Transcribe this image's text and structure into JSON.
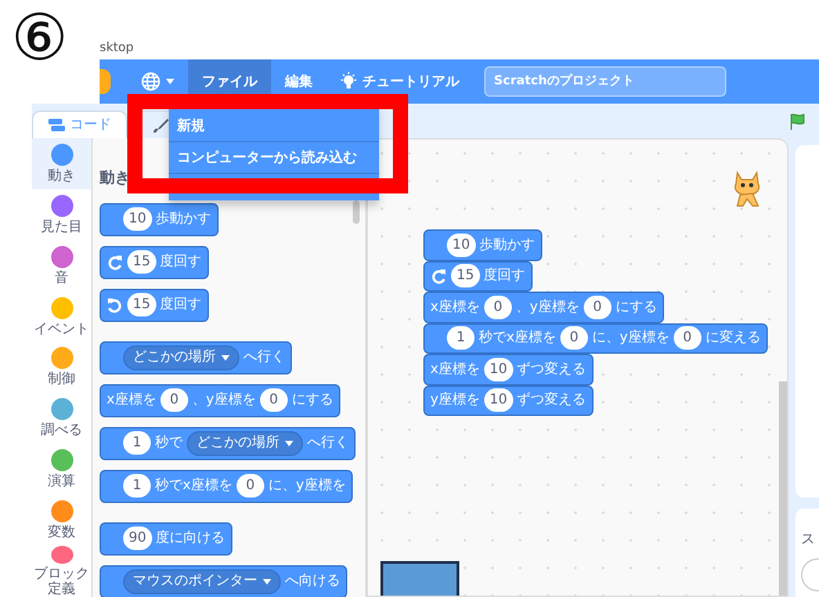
{
  "annotation": {
    "step": "⑥"
  },
  "window": {
    "title": "sktop"
  },
  "menubar": {
    "items": [
      {
        "kind": "language"
      },
      {
        "kind": "menu",
        "label": "ファイル",
        "selected": true
      },
      {
        "kind": "menu",
        "label": "編集",
        "selected": false
      },
      {
        "kind": "tutorial",
        "label": "チュートリアル"
      }
    ],
    "project_title": "Scratchのプロジェクト"
  },
  "tabs": [
    {
      "kind": "code",
      "label": "コード",
      "selected": true
    },
    {
      "kind": "costume",
      "selected": false
    }
  ],
  "file_menu": {
    "items": [
      "新規",
      "コンピューターから読み込む"
    ]
  },
  "categories": [
    {
      "label": "動き",
      "color": "#4c97ff",
      "selected": true
    },
    {
      "label": "見た目",
      "color": "#9966ff",
      "selected": false
    },
    {
      "label": "音",
      "color": "#cf63cf",
      "selected": false
    },
    {
      "label": "イベント",
      "color": "#ffbf00",
      "selected": false
    },
    {
      "label": "制御",
      "color": "#ffab19",
      "selected": false
    },
    {
      "label": "調べる",
      "color": "#5cb1d6",
      "selected": false
    },
    {
      "label": "演算",
      "color": "#59c059",
      "selected": false
    },
    {
      "label": "変数",
      "color": "#ff8c1a",
      "selected": false
    },
    {
      "label": "ブロック定義",
      "color": "#ff6680",
      "selected": false
    }
  ],
  "palette": {
    "heading": "動き",
    "groups": [
      [
        {
          "parts": [
            {
              "kind": "input",
              "text": "10"
            },
            {
              "kind": "label",
              "text": "歩動かす"
            }
          ]
        },
        {
          "parts": [
            {
              "kind": "cw"
            },
            {
              "kind": "input",
              "text": "15"
            },
            {
              "kind": "label",
              "text": "度回す"
            }
          ]
        },
        {
          "parts": [
            {
              "kind": "ccw"
            },
            {
              "kind": "input",
              "text": "15"
            },
            {
              "kind": "label",
              "text": "度回す"
            }
          ]
        }
      ],
      [
        {
          "parts": [
            {
              "kind": "menu",
              "text": "どこかの場所"
            },
            {
              "kind": "label",
              "text": "へ行く"
            }
          ]
        },
        {
          "parts": [
            {
              "kind": "label",
              "text": "x座標を"
            },
            {
              "kind": "input",
              "text": "0"
            },
            {
              "kind": "label",
              "text": "、y座標を"
            },
            {
              "kind": "input",
              "text": "0"
            },
            {
              "kind": "label",
              "text": "にする"
            }
          ]
        },
        {
          "parts": [
            {
              "kind": "input",
              "text": "1"
            },
            {
              "kind": "label",
              "text": "秒で"
            },
            {
              "kind": "menu",
              "text": "どこかの場所"
            },
            {
              "kind": "label",
              "text": "へ行く"
            }
          ]
        },
        {
          "parts": [
            {
              "kind": "input",
              "text": "1"
            },
            {
              "kind": "label",
              "text": "秒でx座標を"
            },
            {
              "kind": "input",
              "text": "0"
            },
            {
              "kind": "label",
              "text": "に、y座標を"
            }
          ]
        }
      ],
      [
        {
          "parts": [
            {
              "kind": "input",
              "text": "90"
            },
            {
              "kind": "label",
              "text": "度に向ける"
            }
          ]
        },
        {
          "parts": [
            {
              "kind": "menu",
              "text": "マウスのポインター"
            },
            {
              "kind": "label",
              "text": "へ向ける"
            }
          ]
        }
      ]
    ]
  },
  "script": {
    "blocks": [
      {
        "parts": [
          {
            "kind": "input",
            "text": "10"
          },
          {
            "kind": "label",
            "text": "歩動かす"
          }
        ]
      },
      {
        "parts": [
          {
            "kind": "cw"
          },
          {
            "kind": "input",
            "text": "15"
          },
          {
            "kind": "label",
            "text": "度回す"
          }
        ]
      },
      {
        "parts": [
          {
            "kind": "label",
            "text": "x座標を"
          },
          {
            "kind": "input",
            "text": "0"
          },
          {
            "kind": "label",
            "text": "、y座標を"
          },
          {
            "kind": "input",
            "text": "0"
          },
          {
            "kind": "label",
            "text": "にする"
          }
        ]
      },
      {
        "parts": [
          {
            "kind": "input",
            "text": "1"
          },
          {
            "kind": "label",
            "text": "秒でx座標を"
          },
          {
            "kind": "input",
            "text": "0"
          },
          {
            "kind": "label",
            "text": "に、y座標を"
          },
          {
            "kind": "input",
            "text": "0"
          },
          {
            "kind": "label",
            "text": "に変える"
          }
        ]
      },
      {
        "parts": [
          {
            "kind": "label",
            "text": "x座標を"
          },
          {
            "kind": "input",
            "text": "10"
          },
          {
            "kind": "label",
            "text": "ずつ変える"
          }
        ]
      },
      {
        "parts": [
          {
            "kind": "label",
            "text": "y座標を"
          },
          {
            "kind": "input",
            "text": "10"
          },
          {
            "kind": "label",
            "text": "ずつ変える"
          }
        ]
      }
    ]
  },
  "sprite_panel": {
    "heading": "ス"
  }
}
